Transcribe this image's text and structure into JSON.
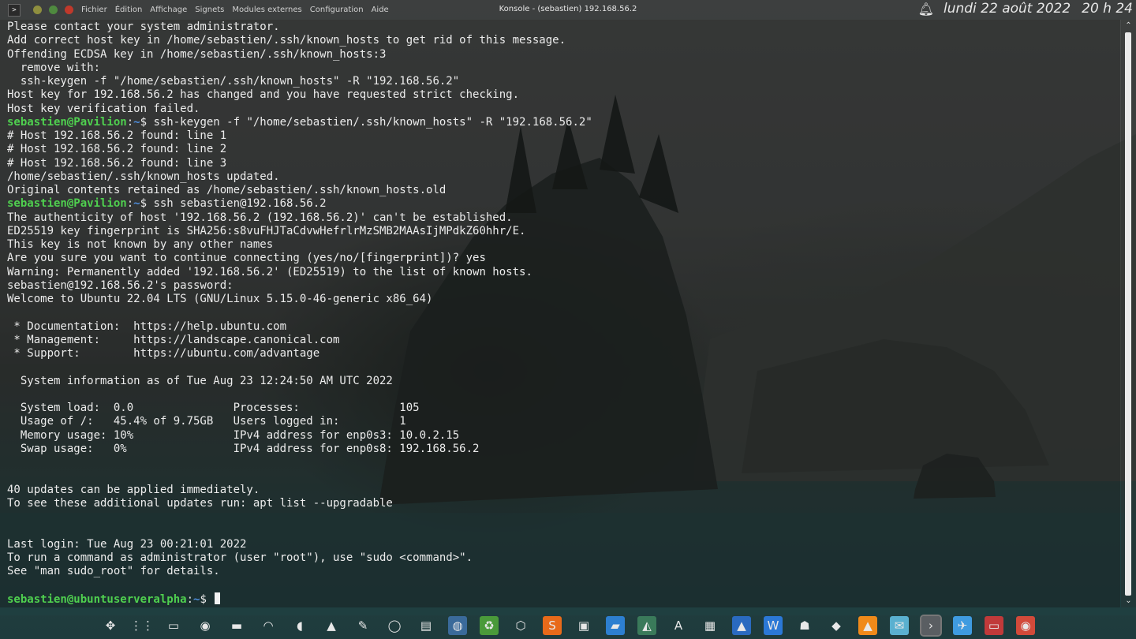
{
  "topbar": {
    "menu": [
      "Fichier",
      "Édition",
      "Affichage",
      "Signets",
      "Modules externes",
      "Configuration",
      "Aide"
    ],
    "window_title": "Konsole - (sebastien) 192.168.56.2",
    "clock_date": "lundi 22 août 2022",
    "clock_time": "20 h 24"
  },
  "terminal": {
    "lines": [
      {
        "text": "Please contact your system administrator."
      },
      {
        "text": "Add correct host key in /home/sebastien/.ssh/known_hosts to get rid of this message."
      },
      {
        "text": "Offending ECDSA key in /home/sebastien/.ssh/known_hosts:3"
      },
      {
        "text": "  remove with:"
      },
      {
        "text": "  ssh-keygen -f \"/home/sebastien/.ssh/known_hosts\" -R \"192.168.56.2\""
      },
      {
        "text": "Host key for 192.168.56.2 has changed and you have requested strict checking."
      },
      {
        "text": "Host key verification failed."
      },
      {
        "user": "sebastien@Pavilion",
        "sep": ":",
        "dir": "~",
        "cmd": "$ ssh-keygen -f \"/home/sebastien/.ssh/known_hosts\" -R \"192.168.56.2\""
      },
      {
        "text": "# Host 192.168.56.2 found: line 1"
      },
      {
        "text": "# Host 192.168.56.2 found: line 2"
      },
      {
        "text": "# Host 192.168.56.2 found: line 3"
      },
      {
        "text": "/home/sebastien/.ssh/known_hosts updated."
      },
      {
        "text": "Original contents retained as /home/sebastien/.ssh/known_hosts.old"
      },
      {
        "user": "sebastien@Pavilion",
        "sep": ":",
        "dir": "~",
        "cmd": "$ ssh sebastien@192.168.56.2"
      },
      {
        "text": "The authenticity of host '192.168.56.2 (192.168.56.2)' can't be established."
      },
      {
        "text": "ED25519 key fingerprint is SHA256:s8vuFHJTaCdvwHefrlrMzSMB2MAAsIjMPdkZ60hhr/E."
      },
      {
        "text": "This key is not known by any other names"
      },
      {
        "text": "Are you sure you want to continue connecting (yes/no/[fingerprint])? yes"
      },
      {
        "text": "Warning: Permanently added '192.168.56.2' (ED25519) to the list of known hosts."
      },
      {
        "text": "sebastien@192.168.56.2's password:"
      },
      {
        "text": "Welcome to Ubuntu 22.04 LTS (GNU/Linux 5.15.0-46-generic x86_64)"
      },
      {
        "text": ""
      },
      {
        "text": " * Documentation:  https://help.ubuntu.com"
      },
      {
        "text": " * Management:     https://landscape.canonical.com"
      },
      {
        "text": " * Support:        https://ubuntu.com/advantage"
      },
      {
        "text": ""
      },
      {
        "text": "  System information as of Tue Aug 23 12:24:50 AM UTC 2022"
      },
      {
        "text": ""
      },
      {
        "text": "  System load:  0.0               Processes:               105"
      },
      {
        "text": "  Usage of /:   45.4% of 9.75GB   Users logged in:         1"
      },
      {
        "text": "  Memory usage: 10%               IPv4 address for enp0s3: 10.0.2.15"
      },
      {
        "text": "  Swap usage:   0%                IPv4 address for enp0s8: 192.168.56.2"
      },
      {
        "text": ""
      },
      {
        "text": ""
      },
      {
        "text": "40 updates can be applied immediately."
      },
      {
        "text": "To see these additional updates run: apt list --upgradable"
      },
      {
        "text": ""
      },
      {
        "text": ""
      },
      {
        "text": "Last login: Tue Aug 23 00:21:01 2022"
      },
      {
        "text": "To run a command as administrator (user \"root\"), use \"sudo <command>\"."
      },
      {
        "text": "See \"man sudo_root\" for details."
      },
      {
        "text": ""
      },
      {
        "user": "sebastien@ubuntuserveralpha",
        "sep": ":",
        "dir": "~",
        "cmd": "$ ",
        "cursor": true
      }
    ]
  },
  "taskbar": {
    "icons": [
      "move-icon",
      "app-grid-icon",
      "desktop-icon",
      "bulb-icon",
      "battery-icon",
      "wifi-icon",
      "volume-icon",
      "tray-arrow-icon",
      "pen-icon",
      "circle-icon",
      "notes-icon",
      "firefox-icon",
      "recycle-icon",
      "package-icon",
      "sublime-icon",
      "terminal-dark-icon",
      "folder-code-icon",
      "monitor-chart-icon",
      "font-icon",
      "calculator-icon",
      "android-icon",
      "word-icon",
      "game-icon",
      "inkscape-icon",
      "vlc-icon",
      "mail-icon",
      "konsole-icon",
      "browser-icon",
      "files-icon",
      "chrome-icon"
    ]
  }
}
